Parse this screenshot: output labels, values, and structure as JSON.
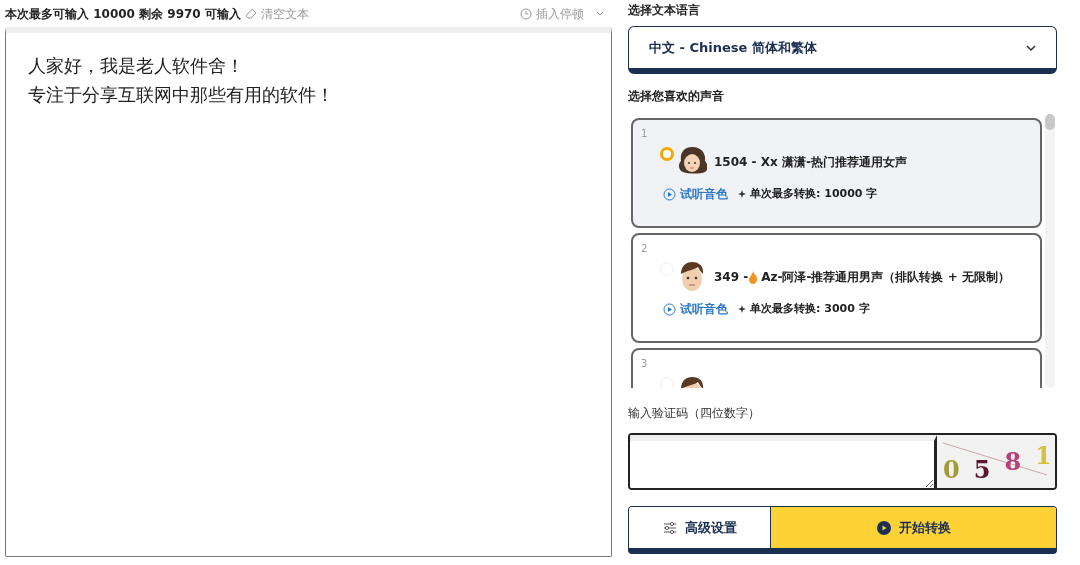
{
  "toolbar": {
    "counter": "本次最多可输入 10000 剩余 9970 可输入",
    "clear": "清空文本",
    "insert_pause": "插入停顿"
  },
  "editor": {
    "lines": [
      "人家好，我是老人软件舍！",
      "专注于分享互联网中那些有用的软件！"
    ]
  },
  "language": {
    "label": "选择文本语言",
    "value": "中文 - Chinese 简体和繁体"
  },
  "voices": {
    "label": "选择您喜欢的声音",
    "items": [
      {
        "number": "1",
        "selected": true,
        "kind": "female",
        "hot": false,
        "name": "1504 - Xx 潇潇-热门推荐通用女声",
        "preview": "试听音色",
        "limit": "单次最多转换: 10000 字"
      },
      {
        "number": "2",
        "selected": false,
        "kind": "male",
        "hot": true,
        "name": "349 - ",
        "name_rest": "Az-阿泽-推荐通用男声（排队转换 + 无限制）",
        "preview": "试听音色",
        "limit": "单次最多转换: 3000 字"
      },
      {
        "number": "3",
        "selected": false,
        "kind": "male"
      }
    ]
  },
  "captcha": {
    "label": "输入验证码（四位数字）",
    "chars": [
      {
        "text": "0",
        "color": "#a39a3a"
      },
      {
        "text": "5",
        "color": "#5c1630"
      },
      {
        "text": "8",
        "color": "#b8407a"
      },
      {
        "text": "1",
        "color": "#d8c040"
      }
    ]
  },
  "buttons": {
    "settings": "高级设置",
    "start": "开始转换"
  }
}
